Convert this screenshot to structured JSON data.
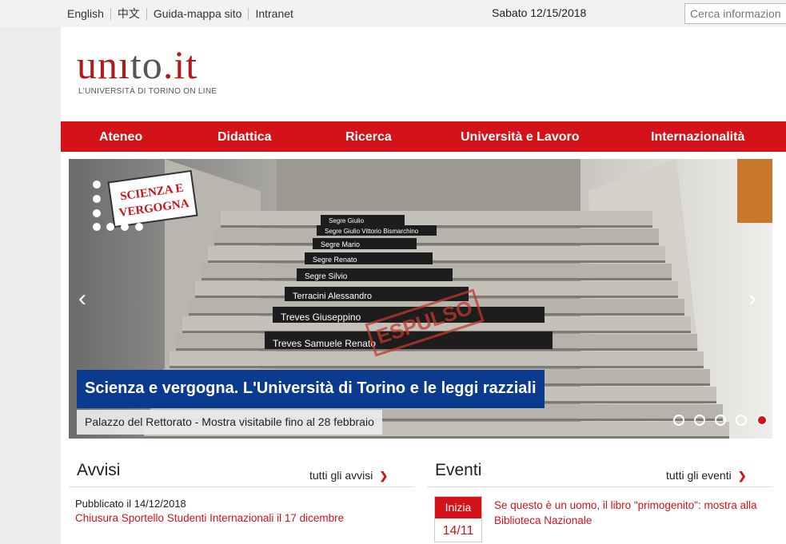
{
  "topbar": {
    "links": [
      "English",
      "中文",
      "Guida-mappa sito",
      "Intranet"
    ],
    "date": "Sabato 12/15/2018",
    "search_placeholder": "Cerca informazioni"
  },
  "logo": {
    "part_u": "un",
    "part_i": "ı",
    "part_to": "to",
    "dot": ".",
    "part_it": "it",
    "subtitle": "L'UNIVERSITÀ DI TORINO ON LINE"
  },
  "nav": [
    "Ateneo",
    "Didattica",
    "Ricerca",
    "Università e Lavoro",
    "Internazionalità"
  ],
  "slider": {
    "title": "Scienza e vergogna. L'Università di Torino e le leggi razziali",
    "subtitle": "Palazzo del Rettorato - Mostra visitabile fino al 28 febbraio",
    "badge_line1": "SCIENZA E",
    "badge_line2": "VERGOGNA",
    "stamp": "ESPULSO",
    "stair_names": [
      "Segre Giulio",
      "Segre Giulio Vittorio Bismarchino",
      "Segre Mario",
      "Segre Renato",
      "Segre Silvio",
      "Terracini Alessandro",
      "Treves Giuseppino",
      "Treves Samuele Renato"
    ],
    "dot_count": 5,
    "active_dot": 4
  },
  "avvisi": {
    "title": "Avvisi",
    "link": "tutti gli avvisi",
    "published": "Pubblicato il 14/12/2018",
    "item": "Chiusura Sportello Studenti Internazionali il 17 dicembre"
  },
  "eventi": {
    "title": "Eventi",
    "link": "tutti gli eventi",
    "badge_top": "Inizia",
    "badge_date": "14/11",
    "item": "Se questo è un uomo, il libro \"primogenito\": mostra alla Biblioteca Nazionale"
  },
  "colors": {
    "brand_red": "#d4121a",
    "caption_blue": "#0b3b8f"
  }
}
